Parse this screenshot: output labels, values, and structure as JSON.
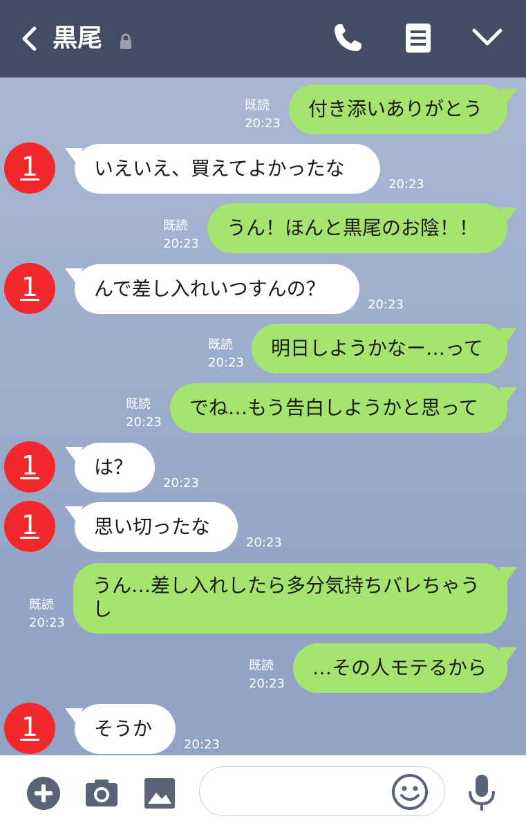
{
  "header": {
    "title": "黒尾",
    "icons": [
      "back-icon",
      "lock-icon",
      "phone-icon",
      "menu-icon",
      "chevron-down-icon"
    ]
  },
  "contact": {
    "avatar_text": "1"
  },
  "messages": [
    {
      "dir": "out",
      "text": "付き添いありがとう",
      "read": "既読",
      "time": "20:23"
    },
    {
      "dir": "in",
      "text": "いえいえ、買えてよかったな",
      "time": "20:23"
    },
    {
      "dir": "out",
      "text": "うん！ほんと黒尾のお陰！！",
      "read": "既読",
      "time": "20:23"
    },
    {
      "dir": "in",
      "text": "んで差し入れいつすんの？",
      "time": "20:23"
    },
    {
      "dir": "out",
      "text": "明日しようかなー…って",
      "read": "既読",
      "time": "20:23"
    },
    {
      "dir": "out",
      "text": "でね…もう告白しようかと思って",
      "read": "既読",
      "time": "20:23"
    },
    {
      "dir": "in",
      "text": "は？",
      "time": "20:23"
    },
    {
      "dir": "in",
      "text": "思い切ったな",
      "time": "20:23"
    },
    {
      "dir": "out",
      "text": "うん…差し入れしたら多分気持ちバレちゃうし",
      "read": "既読",
      "time": "20:23"
    },
    {
      "dir": "out",
      "text": "…その人モテるから",
      "read": "既読",
      "time": "20:23"
    },
    {
      "dir": "in",
      "text": "そうか",
      "time": "20:23"
    }
  ],
  "input": {
    "placeholder": ""
  },
  "footer": {
    "icons": [
      "plus-icon",
      "camera-icon",
      "image-icon",
      "smile-icon",
      "microphone-icon"
    ]
  },
  "colors": {
    "header": "#444c64",
    "out_bubble": "#a5e46f",
    "in_bubble": "#ffffff",
    "avatar": "#f2282d"
  }
}
